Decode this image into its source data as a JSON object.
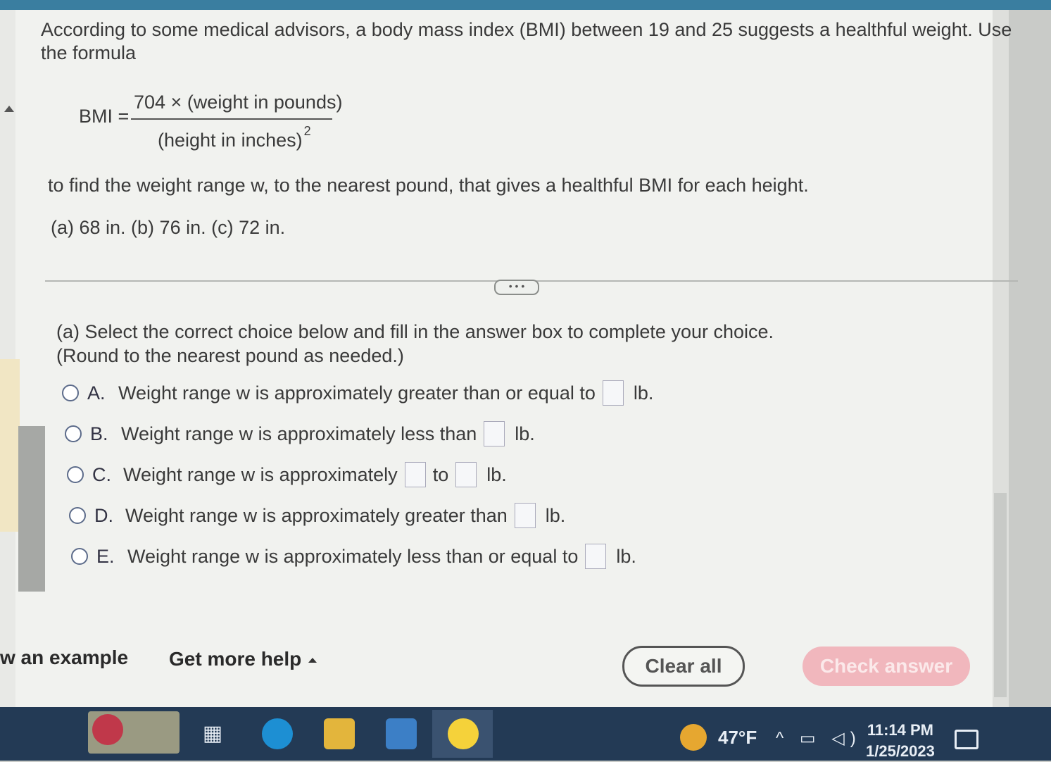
{
  "question": {
    "intro": "According to some medical advisors, a body mass index (BMI) between 19 and 25 suggests a healthful weight. Use the formula",
    "formula_lhs": "BMI =",
    "formula_numerator": "704 × (weight in pounds)",
    "formula_denominator": "(height in inches)",
    "formula_exponent": "2",
    "instruction": "to find the weight range w, to the nearest pound, that gives a healthful BMI for each height.",
    "heights": "(a) 68 in. (b) 76 in. (c) 72 in."
  },
  "expander_label": "• • •",
  "part_a": {
    "prompt": "(a) Select the correct choice below and fill in the answer box to complete your choice.",
    "note": "(Round to the nearest pound as needed.)",
    "choices": [
      {
        "letter": "A.",
        "text": "Weight range w is approximately greater than or equal to",
        "unit": "lb."
      },
      {
        "letter": "B.",
        "text": "Weight range w is approximately less than",
        "unit": "lb."
      },
      {
        "letter": "C.",
        "text": "Weight range w is approximately",
        "mid": "to",
        "unit": "lb."
      },
      {
        "letter": "D.",
        "text": "Weight range w is approximately greater than",
        "unit": "lb."
      },
      {
        "letter": "E.",
        "text": "Weight range w is approximately less than or equal to",
        "unit": "lb."
      }
    ]
  },
  "footer": {
    "example_link": "w an example",
    "get_more_help": "Get more help",
    "clear_all": "Clear all",
    "check_answer": "Check answer"
  },
  "taskbar": {
    "temperature": "47°F",
    "time": "11:14 PM",
    "date": "1/25/2023",
    "icons": [
      "widgets-icon",
      "edge-icon",
      "file-explorer-icon",
      "store-icon",
      "chrome-icon"
    ]
  },
  "colors": {
    "check_answer_bg": "#f1b7bd",
    "taskbar_bg": "#233a55",
    "page_bg": "#f1f2ef"
  }
}
